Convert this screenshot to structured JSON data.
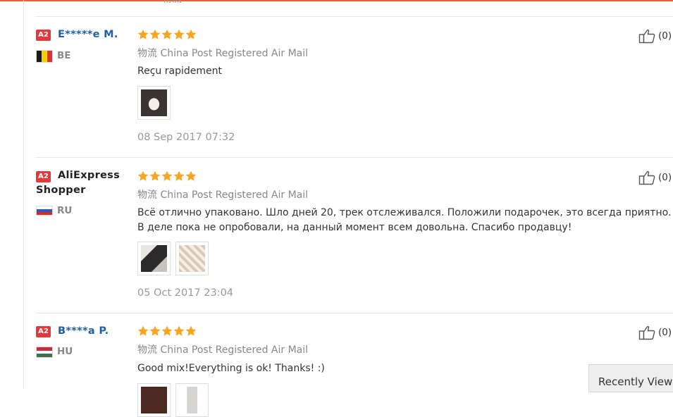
{
  "colors": {
    "accent": "#e8612c",
    "star": "#f5a623",
    "badge": "#e4393c",
    "name_link": "#1f5fa8"
  },
  "reviews": [
    {
      "badge": "A2",
      "name": "E*****e M.",
      "country": "BE",
      "flag": "belgium",
      "rating": 5,
      "shipping_label": "物流",
      "shipping": "China Post Registered Air Mail",
      "text": "Reçu rapidement",
      "photos": 1,
      "date": "08 Sep 2017 07:32",
      "likes": "(0)"
    },
    {
      "badge": "A2",
      "name": "AliExpress Shopper",
      "country": "RU",
      "flag": "russia",
      "rating": 5,
      "shipping_label": "物流",
      "shipping": "China Post Registered Air Mail",
      "text": "Всё отлично упаковано. Шло дней 20, трек отслеживался. Положили подарочек, это всегда приятно. В деле пока не опробовали, на данный момент всем довольна. Спасибо продавцу!",
      "photos": 2,
      "date": "05 Oct 2017 23:04",
      "likes": "(0)"
    },
    {
      "badge": "A2",
      "name": "B****a P.",
      "country": "HU",
      "flag": "hungary",
      "rating": 5,
      "shipping_label": "物流",
      "shipping": "China Post Registered Air Mail",
      "text": "Good mix!Everything is ok! Thanks! :)",
      "photos": 2,
      "date": "",
      "likes": "(0)"
    }
  ],
  "recently_viewed": "Recently Viewed"
}
